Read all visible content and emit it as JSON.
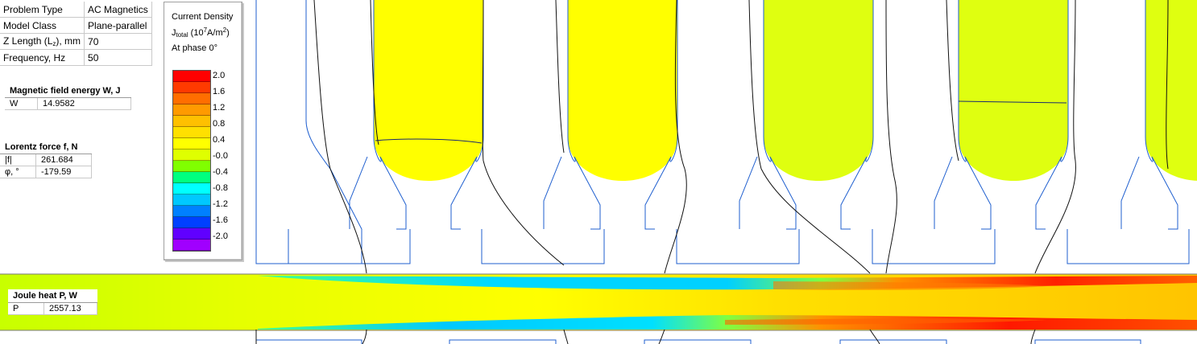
{
  "properties": [
    {
      "key": "Problem Type",
      "value": "AC Magnetics"
    },
    {
      "key": "Model Class",
      "value": "Plane-parallel"
    },
    {
      "key": "Z Length (Lz), mm",
      "key_main": "Z Length (L",
      "key_sub": "z",
      "key_tail": "), mm",
      "value": "70"
    },
    {
      "key": "Frequency, Hz",
      "value": "50"
    }
  ],
  "energy": {
    "title": "Magnetic field energy W, J",
    "label": "W",
    "value": "14.9582"
  },
  "lorentz": {
    "title": "Lorentz force f, N",
    "rows": [
      {
        "label": "|f|",
        "value": "261.684"
      },
      {
        "label": "φ, °",
        "value": "-179.59"
      }
    ]
  },
  "joule": {
    "title": "Joule heat P, W",
    "label": "P",
    "value": "2557.13"
  },
  "legend": {
    "title": "Current Density",
    "quantity": "J",
    "quantity_sub": "total",
    "unit_open": " (10",
    "unit_exp": "7",
    "unit_mid": "A/m",
    "unit_exp2": "2",
    "unit_close": ")",
    "phase": "At phase 0°",
    "ticks": [
      "2.0",
      "1.6",
      "1.2",
      "0.8",
      "0.4",
      "-0.0",
      "-0.4",
      "-0.8",
      "-1.2",
      "-1.6",
      "-2.0"
    ],
    "colors": [
      "#ff0000",
      "#ff3a00",
      "#ff6e00",
      "#ff9a00",
      "#ffc000",
      "#ffe000",
      "#ffff00",
      "#dfff00",
      "#80ff00",
      "#00ff80",
      "#00ffff",
      "#00c8ff",
      "#0080ff",
      "#0040ff",
      "#6000ff",
      "#a000ff"
    ]
  },
  "colors": {
    "outline_blue": "#1f5fcf",
    "conductor_yellow": "#ffff00",
    "conductor_lime": "#dfff10"
  }
}
